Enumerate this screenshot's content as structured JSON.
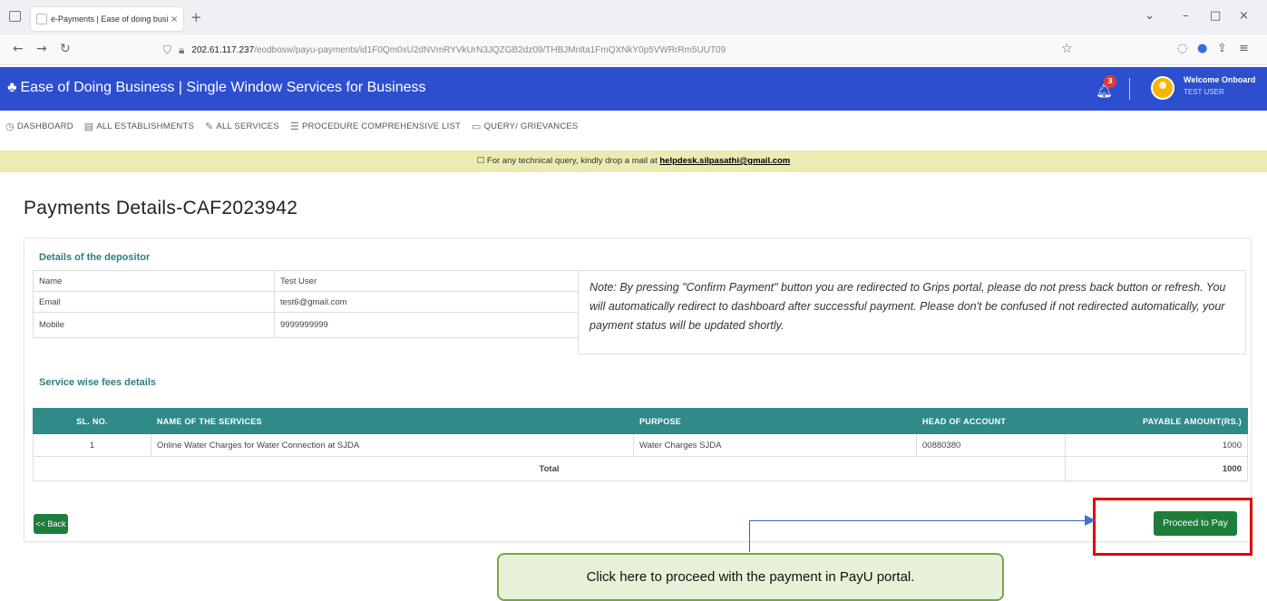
{
  "browser": {
    "tab_title": "e-Payments | Ease of doing business",
    "tab_close": "×",
    "new_tab": "+",
    "url_host": "202.61.117.237",
    "url_path": "/eodbosw/payu-payments/id1F0Qm0xU2dNVmRYVkUrN3JQZGB2dz09/THBJMnlta1FmQXNkY0p5VWRrRm5UUT09",
    "window_controls": [
      "⌄",
      "–",
      "□",
      "×"
    ]
  },
  "header": {
    "brand": "Ease of Doing Business | Single Window Services for Business",
    "notification_count": "3",
    "welcome": "Welcome Onboard",
    "user": "TEST USER"
  },
  "menu": {
    "items": [
      {
        "label": "DASHBOARD",
        "icon": "dashboard-icon"
      },
      {
        "label": "ALL ESTABLISHMENTS",
        "icon": "building-icon"
      },
      {
        "label": "ALL SERVICES",
        "icon": "wrench-icon"
      },
      {
        "label": "PROCEDURE COMPREHENSIVE LIST",
        "icon": "list-icon"
      },
      {
        "label": "QUERY/ GRIEVANCES",
        "icon": "message-icon"
      }
    ]
  },
  "notice": {
    "text": "For any technical query, kindly drop a mail at",
    "email": "helpdesk.silpasathi@gmail.com"
  },
  "page": {
    "title": "Payments Details-CAF2023942"
  },
  "depositor": {
    "section_title": "Details of the depositor",
    "rows": [
      {
        "label": "Name",
        "value": "Test User"
      },
      {
        "label": "Email",
        "value": "test6@gmail.com"
      },
      {
        "label": "Mobile",
        "value": "9999999999"
      }
    ],
    "note": "Note: By pressing \"Confirm Payment\" button you are redirected to Grips portal, please do not press back button or refresh. You will automatically redirect to dashboard after successful payment. Please don't be confused if not redirected automatically, your payment status will be updated shortly."
  },
  "fees": {
    "section_title": "Service wise fees details",
    "columns": [
      "SL. NO.",
      "NAME OF THE SERVICES",
      "PURPOSE",
      "HEAD OF ACCOUNT",
      "PAYABLE AMOUNT(RS.)"
    ],
    "rows": [
      {
        "sl": "1",
        "service": "Online Water Charges for Water Connection at SJDA",
        "purpose": "Water Charges SJDA",
        "head": "00880380",
        "amount": "1000"
      }
    ],
    "total_label": "Total",
    "total_value": "1000"
  },
  "actions": {
    "back": "<< Back",
    "pay": "Proceed to Pay"
  },
  "annotation": {
    "callout": "Click here to proceed with the payment in PayU portal.",
    "highlight_color": "#e30000"
  }
}
